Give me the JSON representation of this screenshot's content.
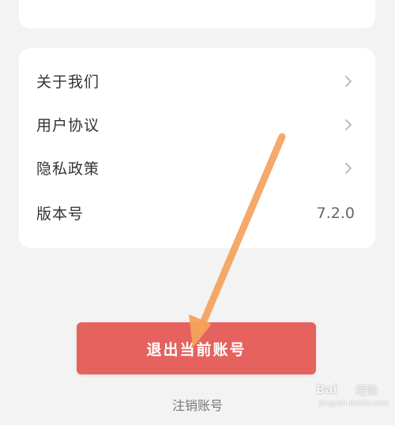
{
  "menu": {
    "items": [
      {
        "label": "关于我们",
        "icon": "chevron-right-icon"
      },
      {
        "label": "用户协议",
        "icon": "chevron-right-icon"
      },
      {
        "label": "隐私政策",
        "icon": "chevron-right-icon"
      }
    ],
    "version": {
      "label": "版本号",
      "value": "7.2.0"
    }
  },
  "actions": {
    "logout_label": "退出当前账号",
    "cancel_account_label": "注销账号"
  },
  "watermark": {
    "brand": "Bai",
    "brand2": "经验",
    "url": "jingyan.baidu.com"
  },
  "colors": {
    "background": "#f3f3f3",
    "card": "#ffffff",
    "logout_button": "#e5625e",
    "annotation_arrow": "#f5a05a"
  },
  "annotation": {
    "type": "arrow",
    "icon": "orange-arrow-icon",
    "points_to": "logout-button"
  }
}
